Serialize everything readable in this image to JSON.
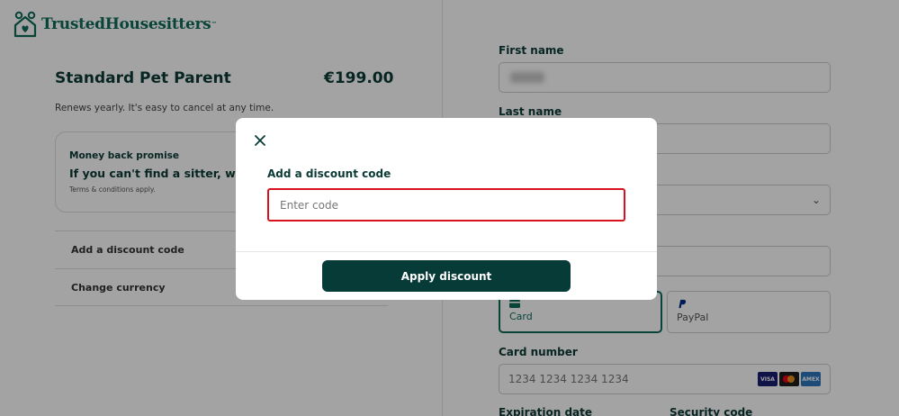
{
  "brand": {
    "name": "TrustedHousesitters",
    "tm": "™"
  },
  "plan": {
    "title": "Standard Pet Parent",
    "price": "€199.00",
    "renew_text": "Renews yearly. It's easy to cancel at any time."
  },
  "promise": {
    "label": "Money back promise",
    "text": "If you can't find a sitter, we'll ref",
    "terms": "Terms & conditions apply."
  },
  "accordion": {
    "discount_label": "Add a discount code",
    "currency_label": "Change currency"
  },
  "form": {
    "first_name_label": "First name",
    "last_name_label": "Last name",
    "payment_card_label": "Card",
    "payment_paypal_label": "PayPal",
    "card_number_label": "Card number",
    "card_number_placeholder": "1234 1234 1234 1234",
    "expiration_label": "Expiration date",
    "security_label": "Security code",
    "card_brands": [
      "VISA",
      "mastercard",
      "AMEX"
    ]
  },
  "modal": {
    "title": "Add a discount code",
    "input_placeholder": "Enter code",
    "input_value": "",
    "apply_label": "Apply discount"
  },
  "colors": {
    "brand_green": "#0f6b5a",
    "dark_green": "#073b37",
    "error_red": "#d9121f"
  }
}
